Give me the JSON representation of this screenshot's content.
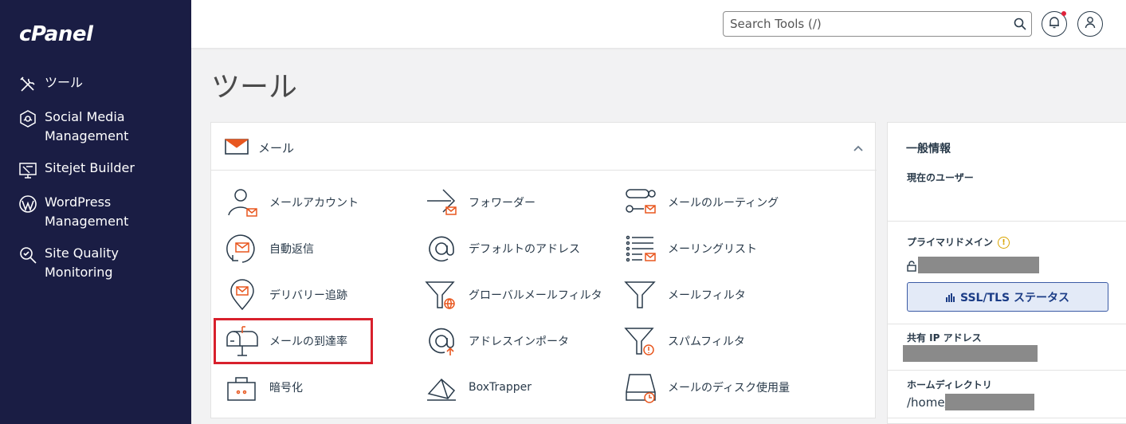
{
  "brand": {
    "logo_text": "cPanel"
  },
  "sidebar": {
    "items": [
      {
        "label": "ツール",
        "icon": "tools-icon"
      },
      {
        "label": "Social Media Management",
        "icon": "social-media-icon"
      },
      {
        "label": "Sitejet Builder",
        "icon": "sitejet-icon"
      },
      {
        "label": "WordPress Management",
        "icon": "wordpress-icon"
      },
      {
        "label": "Site Quality Monitoring",
        "icon": "site-quality-icon"
      }
    ]
  },
  "header": {
    "search_placeholder": "Search Tools (/)"
  },
  "page": {
    "title": "ツール"
  },
  "mail_section": {
    "title": "メール",
    "tools": [
      {
        "label": "メールアカウント",
        "icon": "email-accounts-icon"
      },
      {
        "label": "フォワーダー",
        "icon": "forwarders-icon"
      },
      {
        "label": "メールのルーティング",
        "icon": "email-routing-icon"
      },
      {
        "label": "自動返信",
        "icon": "autoresponders-icon"
      },
      {
        "label": "デフォルトのアドレス",
        "icon": "default-address-icon"
      },
      {
        "label": "メーリングリスト",
        "icon": "mailing-lists-icon"
      },
      {
        "label": "デリバリー追跡",
        "icon": "track-delivery-icon"
      },
      {
        "label": "グローバルメールフィルタ",
        "icon": "global-email-filters-icon"
      },
      {
        "label": "メールフィルタ",
        "icon": "email-filters-icon"
      },
      {
        "label": "メールの到達率",
        "icon": "email-deliverability-icon"
      },
      {
        "label": "アドレスインポータ",
        "icon": "address-importer-icon"
      },
      {
        "label": "スパムフィルタ",
        "icon": "spam-filters-icon"
      },
      {
        "label": "暗号化",
        "icon": "encryption-icon"
      },
      {
        "label": "BoxTrapper",
        "icon": "boxtrapper-icon"
      },
      {
        "label": "メールのディスク使用量",
        "icon": "email-disk-usage-icon"
      }
    ]
  },
  "general_info": {
    "title": "一般情報",
    "current_user_label": "現在のユーザー",
    "primary_domain_label": "プライマリドメイン",
    "ssl_button_label": "SSL/TLS ステータス",
    "shared_ip_label": "共有 IP アドレス",
    "home_dir_label": "ホームディレクトリ",
    "home_dir_value": "/home/"
  },
  "colors": {
    "sidebar_bg": "#1a1d44",
    "accent_orange": "#e8571f",
    "highlight_red": "#d8202c",
    "ssl_button_bg": "#e3eaf7"
  }
}
